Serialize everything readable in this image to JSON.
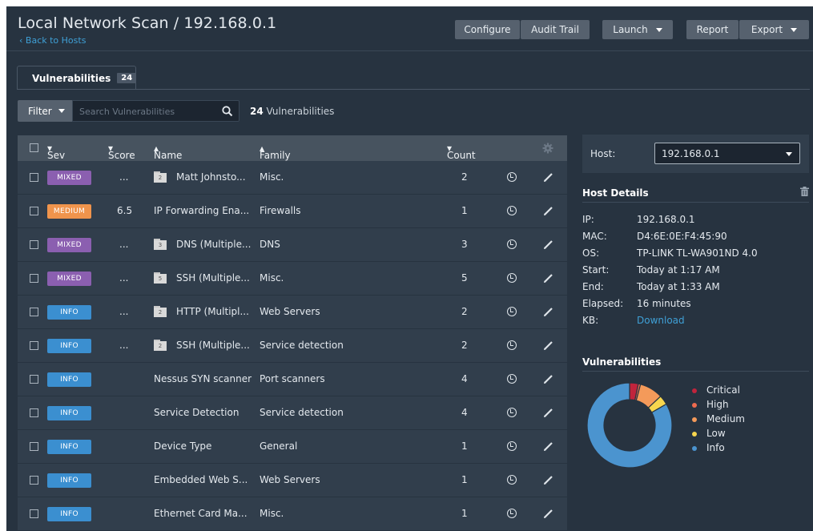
{
  "header": {
    "title": "Local Network Scan / 192.168.0.1",
    "back_link": "Back to Hosts",
    "buttons": {
      "configure": "Configure",
      "audit_trail": "Audit Trail",
      "launch": "Launch",
      "report": "Report",
      "export": "Export"
    }
  },
  "tabs": [
    {
      "label": "Vulnerabilities",
      "count": "24"
    }
  ],
  "filter": {
    "label": "Filter",
    "search_placeholder": "Search Vulnerabilities",
    "result_count": "24",
    "result_label": "Vulnerabilities"
  },
  "table": {
    "columns": {
      "sev": "Sev",
      "score": "Score",
      "name": "Name",
      "family": "Family",
      "count": "Count"
    },
    "rows": [
      {
        "sev": "MIXED",
        "sev_color": "#8b5fb0",
        "score": "...",
        "group_count": "2",
        "name": "Matt Johnsto...",
        "family": "Misc.",
        "count": "2"
      },
      {
        "sev": "MEDIUM",
        "sev_color": "#f0944c",
        "score": "6.5",
        "group_count": "",
        "name": "IP Forwarding Ena...",
        "family": "Firewalls",
        "count": "1"
      },
      {
        "sev": "MIXED",
        "sev_color": "#8b5fb0",
        "score": "...",
        "group_count": "3",
        "name": "DNS (Multiple...",
        "family": "DNS",
        "count": "3"
      },
      {
        "sev": "MIXED",
        "sev_color": "#8b5fb0",
        "score": "...",
        "group_count": "5",
        "name": "SSH (Multiple...",
        "family": "Misc.",
        "count": "5"
      },
      {
        "sev": "INFO",
        "sev_color": "#3b8fd0",
        "score": "...",
        "group_count": "2",
        "name": "HTTP (Multipl...",
        "family": "Web Servers",
        "count": "2"
      },
      {
        "sev": "INFO",
        "sev_color": "#3b8fd0",
        "score": "...",
        "group_count": "2",
        "name": "SSH (Multiple...",
        "family": "Service detection",
        "count": "2"
      },
      {
        "sev": "INFO",
        "sev_color": "#3b8fd0",
        "score": "",
        "group_count": "",
        "name": "Nessus SYN scanner",
        "family": "Port scanners",
        "count": "4"
      },
      {
        "sev": "INFO",
        "sev_color": "#3b8fd0",
        "score": "",
        "group_count": "",
        "name": "Service Detection",
        "family": "Service detection",
        "count": "4"
      },
      {
        "sev": "INFO",
        "sev_color": "#3b8fd0",
        "score": "",
        "group_count": "",
        "name": "Device Type",
        "family": "General",
        "count": "1"
      },
      {
        "sev": "INFO",
        "sev_color": "#3b8fd0",
        "score": "",
        "group_count": "",
        "name": "Embedded Web S...",
        "family": "Web Servers",
        "count": "1"
      },
      {
        "sev": "INFO",
        "sev_color": "#3b8fd0",
        "score": "",
        "group_count": "",
        "name": "Ethernet Card Ma...",
        "family": "Misc.",
        "count": "1"
      }
    ]
  },
  "host": {
    "label": "Host:",
    "selected": "192.168.0.1"
  },
  "host_details": {
    "title": "Host Details",
    "items": [
      {
        "key": "IP:",
        "value": "192.168.0.1"
      },
      {
        "key": "MAC:",
        "value": "D4:6E:0E:F4:45:90"
      },
      {
        "key": "OS:",
        "value": "TP-LINK TL-WA901ND 4.0"
      },
      {
        "key": "Start:",
        "value": "Today at 1:17 AM"
      },
      {
        "key": "End:",
        "value": "Today at 1:33 AM"
      },
      {
        "key": "Elapsed:",
        "value": "16 minutes"
      },
      {
        "key": "KB:",
        "value": "Download"
      }
    ]
  },
  "vuln_summary": {
    "title": "Vulnerabilities",
    "legend": [
      {
        "label": "Critical",
        "color": "#c0243c"
      },
      {
        "label": "High",
        "color": "#ef6b4f"
      },
      {
        "label": "Medium",
        "color": "#f49a5a"
      },
      {
        "label": "Low",
        "color": "#f7d64e"
      },
      {
        "label": "Info",
        "color": "#4b94cf"
      }
    ]
  }
}
